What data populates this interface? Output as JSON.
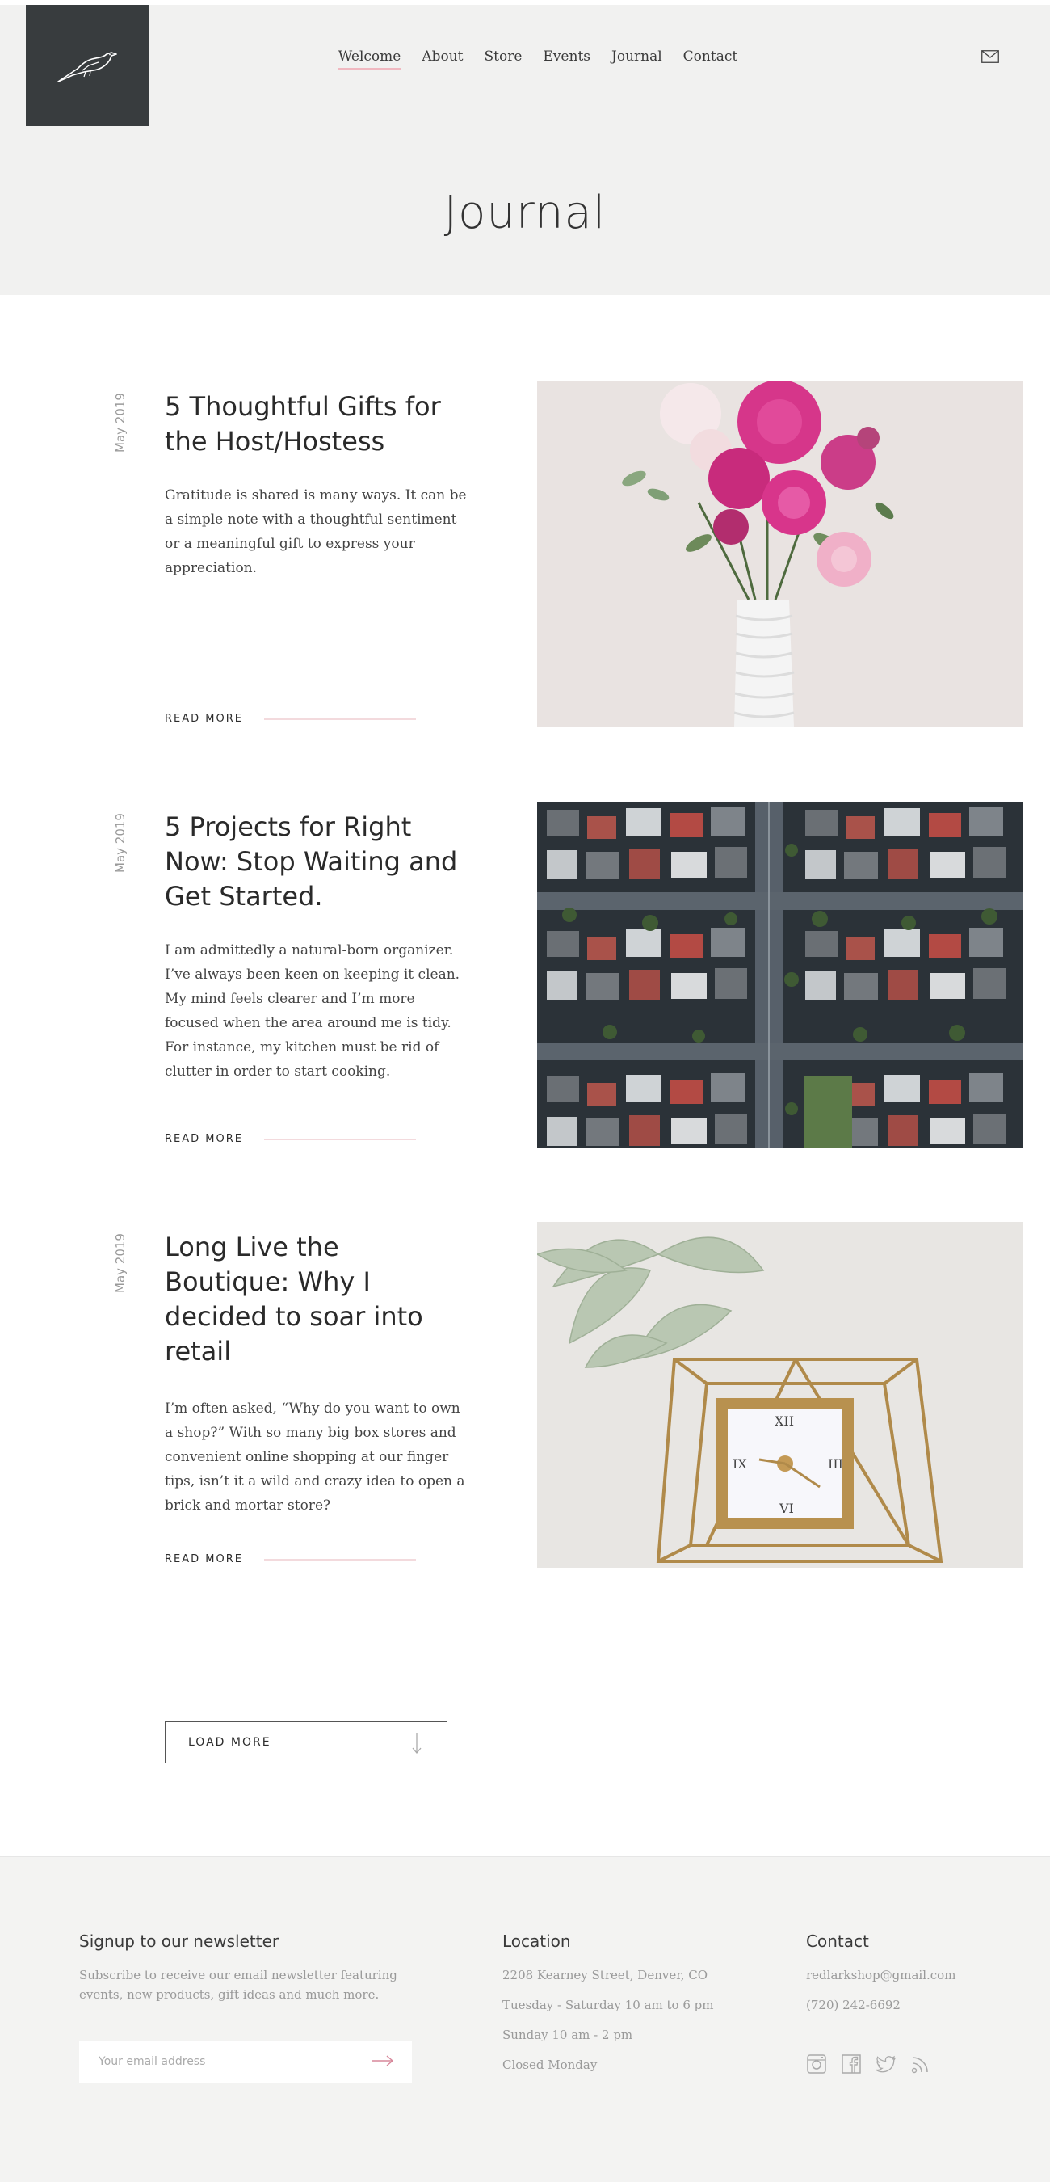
{
  "nav": {
    "items": [
      {
        "label": "Welcome",
        "active": true
      },
      {
        "label": "About"
      },
      {
        "label": "Store"
      },
      {
        "label": "Events"
      },
      {
        "label": "Journal"
      },
      {
        "label": "Contact"
      }
    ],
    "mail_icon": "envelope-icon"
  },
  "page": {
    "title": "Journal"
  },
  "posts": [
    {
      "date": "May 2019",
      "title": "5 Thoughtful Gifts for the Host/Hostess",
      "excerpt": "Gratitude is shared is many ways. It can be a simple note with a thoughtful sentiment or a meaningful gift to express your appreciation.",
      "read_more": "READ MORE",
      "image": "pink-flowers-in-white-vase"
    },
    {
      "date": "May 2019",
      "title": "5 Projects for Right Now: Stop Waiting and Get Started.",
      "excerpt": "I am admittedly a natural-born organizer. I’ve always been keen on keeping it clean. My mind feels clearer and I’m more focused when the area around me is tidy. For instance, my kitchen must be rid of clutter in order to start cooking.",
      "read_more": "READ MORE",
      "image": "aerial-view-of-neighborhood"
    },
    {
      "date": "May 2019",
      "title": "Long Live the Boutique: Why I decided to soar into retail",
      "excerpt": "I’m often asked, “Why do you want to own a shop?” With so many big box stores and convenient online shopping at our finger tips, isn’t it a wild and crazy idea to open a brick and mortar store?",
      "read_more": "READ MORE",
      "image": "air-plant-and-gold-clock"
    }
  ],
  "load_more": "LOAD MORE",
  "footer": {
    "newsletter": {
      "heading": "Signup to our newsletter",
      "text": "Subscribe to receive our email newsletter featuring events, new products, gift ideas and much more.",
      "placeholder": "Your email address"
    },
    "location": {
      "heading": "Location",
      "address": "2208 Kearney Street, Denver, CO",
      "hours1": "Tuesday - Saturday 10 am to 6 pm",
      "hours2": "Sunday 10 am - 2 pm",
      "hours3": "Closed Monday"
    },
    "contact": {
      "heading": "Contact",
      "email": "redlarkshop@gmail.com",
      "phone": "(720) 242-6692",
      "social_icons": [
        "instagram-icon",
        "facebook-icon",
        "twitter-icon",
        "rss-icon"
      ]
    }
  },
  "colors": {
    "logo_bg": "#383c3e",
    "hero_bg": "#f1f1f0",
    "accent_pink": "#f0b8c0",
    "footer_bg": "#f3f3f2"
  }
}
